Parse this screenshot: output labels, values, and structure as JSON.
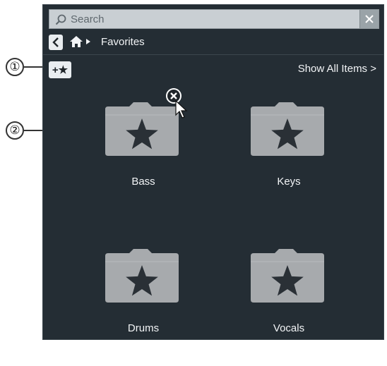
{
  "search": {
    "placeholder": "Search"
  },
  "breadcrumb": {
    "current": "Favorites"
  },
  "toolbar": {
    "add_favorite_label": "+★",
    "show_all_label": "Show All Items >"
  },
  "folders": [
    {
      "label": "Bass"
    },
    {
      "label": "Keys"
    },
    {
      "label": "Drums"
    },
    {
      "label": "Vocals"
    }
  ],
  "callouts": [
    "①",
    "②"
  ],
  "colors": {
    "panel_bg": "#242d34",
    "folder_fill": "#a7aaad",
    "star_fill": "#2a3036"
  },
  "icons": {
    "search": "search-icon",
    "back": "back-arrow-icon",
    "home": "home-icon",
    "remove": "remove-icon",
    "folder_star": "star-folder-icon"
  }
}
